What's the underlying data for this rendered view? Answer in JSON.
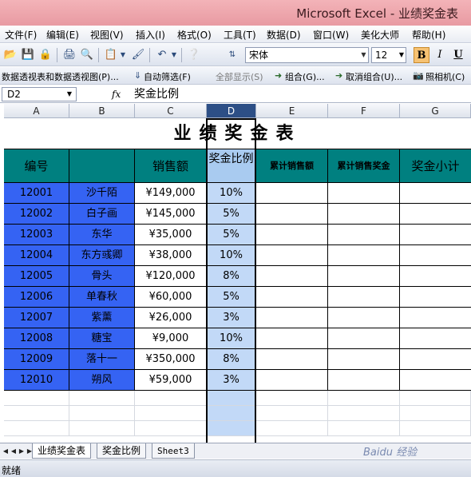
{
  "window": {
    "title": "Microsoft Excel - 业绩奖金表"
  },
  "menu": [
    "文件(F)",
    "编辑(E)",
    "视图(V)",
    "插入(I)",
    "格式(O)",
    "工具(T)",
    "数据(D)",
    "窗口(W)",
    "美化大师",
    "帮助(H)"
  ],
  "toolbar": {
    "font_name": "宋体",
    "font_size": "12",
    "bold": "B",
    "italic": "I",
    "underline": "U"
  },
  "toolbar2": {
    "pivot": "数据透视表和数据透视图(P)...",
    "autofilter": "自动筛选(F)",
    "show_all": "全部显示(S)",
    "group": "组合(G)...",
    "ungroup": "取消组合(U)...",
    "camera": "照相机(C)"
  },
  "formula_bar": {
    "cell_ref": "D2",
    "fx": "fx",
    "value": "奖金比例"
  },
  "columns": [
    "A",
    "B",
    "C",
    "D",
    "E",
    "F",
    "G"
  ],
  "sheet": {
    "title": "业绩奖金表",
    "headers": [
      "编号",
      "",
      "销售额",
      "奖金比例",
      "累计销售额",
      "累计销售奖金",
      "奖金小计"
    ],
    "rows": [
      [
        "12001",
        "沙千陌",
        "¥149,000",
        "10%"
      ],
      [
        "12002",
        "白子画",
        "¥145,000",
        "5%"
      ],
      [
        "12003",
        "东华",
        "¥35,000",
        "5%"
      ],
      [
        "12004",
        "东方彧卿",
        "¥38,000",
        "10%"
      ],
      [
        "12005",
        "骨头",
        "¥120,000",
        "8%"
      ],
      [
        "12006",
        "单春秋",
        "¥60,000",
        "5%"
      ],
      [
        "12007",
        "紫薰",
        "¥26,000",
        "3%"
      ],
      [
        "12008",
        "糖宝",
        "¥9,000",
        "10%"
      ],
      [
        "12009",
        "落十一",
        "¥350,000",
        "8%"
      ],
      [
        "12010",
        "朔风",
        "¥59,000",
        "3%"
      ]
    ]
  },
  "tabs": [
    "业绩奖金表",
    "奖金比例",
    "Sheet3"
  ],
  "status": {
    "text": "就绪"
  },
  "watermark": "Baidu 经验",
  "colors": {
    "teal_header": "#008080",
    "blue_cells": "#3563f3",
    "selected_column": "#c2d9f7",
    "title_bar": "#f3b3b8"
  }
}
